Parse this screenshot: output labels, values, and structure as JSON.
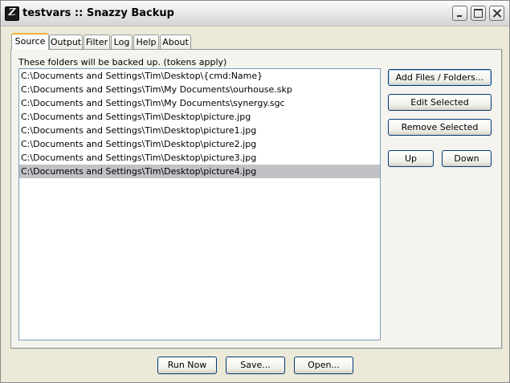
{
  "window": {
    "title": "testvars :: Snazzy Backup",
    "icon": "Z"
  },
  "tabs": [
    {
      "label": "Source",
      "active": true
    },
    {
      "label": "Output",
      "active": false
    },
    {
      "label": "Filter",
      "active": false
    },
    {
      "label": "Log",
      "active": false
    },
    {
      "label": "Help",
      "active": false
    },
    {
      "label": "About",
      "active": false
    }
  ],
  "source": {
    "description": "These folders will be backed up. (tokens apply)",
    "items": [
      "C:\\Documents and Settings\\Tim\\Desktop\\{cmd:Name}",
      "C:\\Documents and Settings\\Tim\\My Documents\\ourhouse.skp",
      "C:\\Documents and Settings\\Tim\\My Documents\\synergy.sgc",
      "C:\\Documents and Settings\\Tim\\Desktop\\picture.jpg",
      "C:\\Documents and Settings\\Tim\\Desktop\\picture1.jpg",
      "C:\\Documents and Settings\\Tim\\Desktop\\picture2.jpg",
      "C:\\Documents and Settings\\Tim\\Desktop\\picture3.jpg",
      "C:\\Documents and Settings\\Tim\\Desktop\\picture4.jpg"
    ],
    "selected_index": 7,
    "buttons": {
      "add": "Add Files / Folders...",
      "edit": "Edit Selected",
      "remove": "Remove Selected",
      "up": "Up",
      "down": "Down"
    }
  },
  "footer": {
    "run": "Run Now",
    "save": "Save...",
    "open": "Open..."
  }
}
